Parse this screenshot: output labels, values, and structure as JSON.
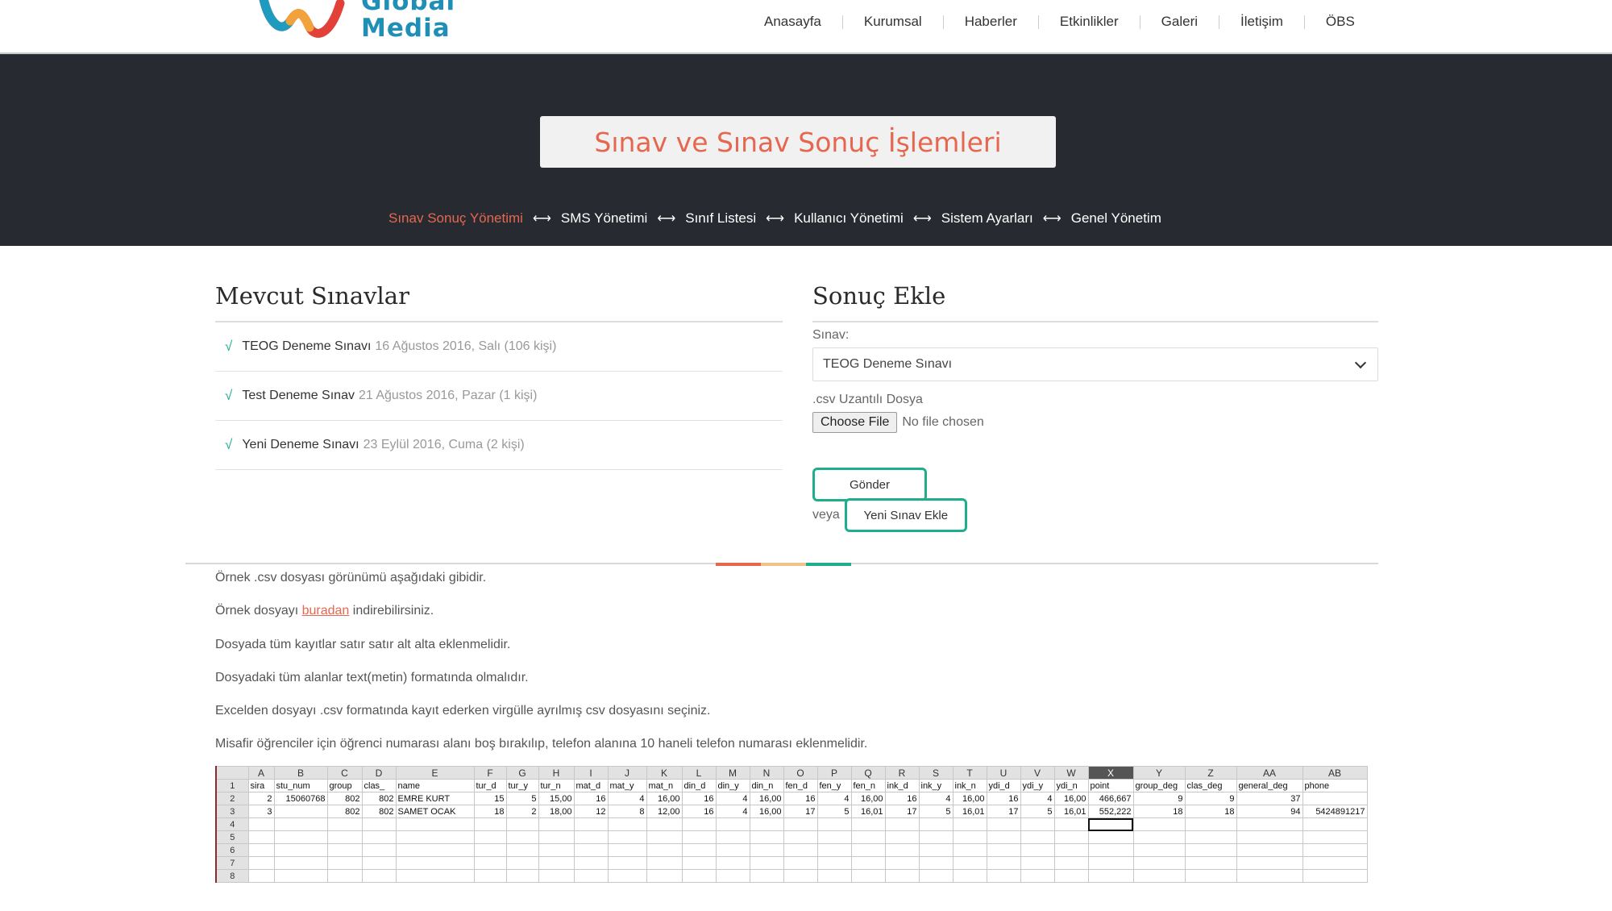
{
  "header": {
    "logo_line1": "Global",
    "logo_line2": "Media",
    "nav": [
      "Anasayfa",
      "Kurumsal",
      "Haberler",
      "Etkinlikler",
      "Galeri",
      "İletişim",
      "ÖBS"
    ]
  },
  "banner": {
    "title": "Sınav ve Sınav Sonuç İşlemleri",
    "subnav": [
      "Sınav Sonuç Yönetimi",
      "SMS Yönetimi",
      "Sınıf Listesi",
      "Kullanıcı Yönetimi",
      "Sistem Ayarları",
      "Genel Yönetim"
    ],
    "arrow_glyph": "⟷",
    "active_color": "#e5674f"
  },
  "exams": {
    "heading": "Mevcut Sınavlar",
    "check_glyph": "√",
    "items": [
      {
        "name": "TEOG Deneme Sınavı",
        "meta": "16 Ağustos 2016, Salı (106 kişi)"
      },
      {
        "name": "Test Deneme Sınav",
        "meta": "21 Ağustos 2016, Pazar (1 kişi)"
      },
      {
        "name": "Yeni Deneme Sınavı",
        "meta": "23 Eylül 2016, Cuma (2 kişi)"
      }
    ]
  },
  "add_result": {
    "heading": "Sonuç Ekle",
    "exam_label": "Sınav:",
    "exam_selected": "TEOG Deneme Sınavı",
    "file_label": ".csv Uzantılı Dosya",
    "file_button": "Choose File",
    "file_status": "No file chosen",
    "send_button": "Gönder",
    "or_text": "veya",
    "new_exam_button": "Yeni Sınav Ekle",
    "accent_color": "#1fae8c"
  },
  "instructions": {
    "line1": "Örnek .csv dosyası görünümü aşağıdaki gibidir.",
    "line2_before": "Örnek dosyayı ",
    "line2_link": "buradan",
    "line2_after": " indirebilirsiniz.",
    "line3": "Dosyada tüm kayıtlar satır satır alt alta eklenmelidir.",
    "line4": "Dosyadaki tüm alanlar text(metin) formatında olmalıdır.",
    "line5": "Excelden dosyayı .csv formatında kayıt ederken virgülle ayrılmış csv dosyasını seçiniz.",
    "line6": "Misafir öğrenciler için öğrenci numarası alanı boş bırakılıp, telefon alanına 10 haneli telefon numarası eklenmelidir."
  },
  "spreadsheet": {
    "columns": [
      "A",
      "B",
      "C",
      "D",
      "E",
      "F",
      "G",
      "H",
      "I",
      "J",
      "K",
      "L",
      "M",
      "N",
      "O",
      "P",
      "Q",
      "R",
      "S",
      "T",
      "U",
      "V",
      "W",
      "X",
      "Y",
      "Z",
      "AA",
      "AB"
    ],
    "selected_column": "X",
    "row_numbers": [
      "1",
      "2",
      "3",
      "4",
      "5",
      "6",
      "7",
      "8"
    ],
    "rows": [
      [
        "sira",
        "stu_num",
        "group",
        "clas_",
        "name",
        "tur_d",
        "tur_y",
        "tur_n",
        "mat_d",
        "mat_y",
        "mat_n",
        "din_d",
        "din_y",
        "din_n",
        "fen_d",
        "fen_y",
        "fen_n",
        "ink_d",
        "ink_y",
        "ink_n",
        "ydi_d",
        "ydi_y",
        "ydi_n",
        "point",
        "group_deg",
        "clas_deg",
        "general_deg",
        "phone"
      ],
      [
        "2",
        "15060768",
        "802",
        "802",
        "EMRE KURT",
        "15",
        "5",
        "15,00",
        "16",
        "4",
        "16,00",
        "16",
        "4",
        "16,00",
        "16",
        "4",
        "16,00",
        "16",
        "4",
        "16,00",
        "16",
        "4",
        "16,00",
        "466,667",
        "9",
        "9",
        "37",
        ""
      ],
      [
        "3",
        "",
        "802",
        "802",
        "SAMET OCAK",
        "18",
        "2",
        "18,00",
        "12",
        "8",
        "12,00",
        "16",
        "4",
        "16,00",
        "17",
        "5",
        "16,01",
        "17",
        "5",
        "16,01",
        "17",
        "5",
        "16,01",
        "552,222",
        "18",
        "18",
        "94",
        "5424891217"
      ],
      [
        "",
        "",
        "",
        "",
        "",
        "",
        "",
        "",
        "",
        "",
        "",
        "",
        "",
        "",
        "",
        "",
        "",
        "",
        "",
        "",
        "",
        "",
        "",
        "",
        "",
        "",
        "",
        ""
      ],
      [
        "",
        "",
        "",
        "",
        "",
        "",
        "",
        "",
        "",
        "",
        "",
        "",
        "",
        "",
        "",
        "",
        "",
        "",
        "",
        "",
        "",
        "",
        "",
        "",
        "",
        "",
        "",
        ""
      ],
      [
        "",
        "",
        "",
        "",
        "",
        "",
        "",
        "",
        "",
        "",
        "",
        "",
        "",
        "",
        "",
        "",
        "",
        "",
        "",
        "",
        "",
        "",
        "",
        "",
        "",
        "",
        "",
        ""
      ],
      [
        "",
        "",
        "",
        "",
        "",
        "",
        "",
        "",
        "",
        "",
        "",
        "",
        "",
        "",
        "",
        "",
        "",
        "",
        "",
        "",
        "",
        "",
        "",
        "",
        "",
        "",
        "",
        ""
      ],
      [
        "",
        "",
        "",
        "",
        "",
        "",
        "",
        "",
        "",
        "",
        "",
        "",
        "",
        "",
        "",
        "",
        "",
        "",
        "",
        "",
        "",
        "",
        "",
        "",
        "",
        "",
        "",
        ""
      ]
    ]
  }
}
